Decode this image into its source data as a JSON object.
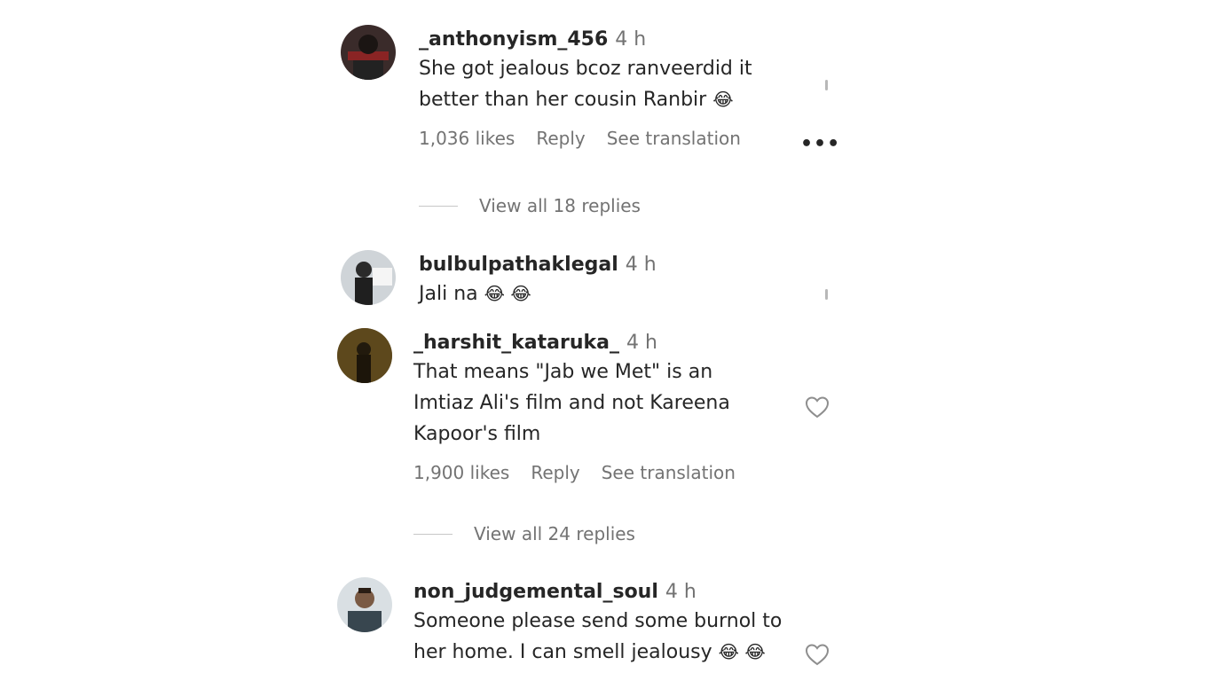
{
  "comments": [
    {
      "username": "_anthonyism_456",
      "time": "4 h",
      "text": "She got jealous bcoz ranveerdid it better than her cousin Ranbir",
      "emoji": "😂",
      "likes": "1,036 likes",
      "reply": "Reply",
      "translate": "See translation",
      "view_replies": "View all 18 replies"
    },
    {
      "username": "bulbulpathaklegal",
      "time": "4 h",
      "text": "Jali na",
      "emoji": "😂 😂"
    },
    {
      "username": "_harshit_kataruka_",
      "time": "4 h",
      "text": "That means \"Jab we Met\" is an Imtiaz Ali's film and not Kareena Kapoor's film",
      "likes": "1,900 likes",
      "reply": "Reply",
      "translate": "See translation",
      "view_replies": "View all 24 replies"
    },
    {
      "username": "non_judgemental_soul",
      "time": "4 h",
      "text": "Someone please send some burnol to her home. I can smell jealousy",
      "emoji": "😂 😂"
    }
  ],
  "icons": {
    "heart": "heart-outline-icon",
    "more": "more-options-icon"
  },
  "colors": {
    "text": "#262626",
    "secondary": "#737373"
  }
}
